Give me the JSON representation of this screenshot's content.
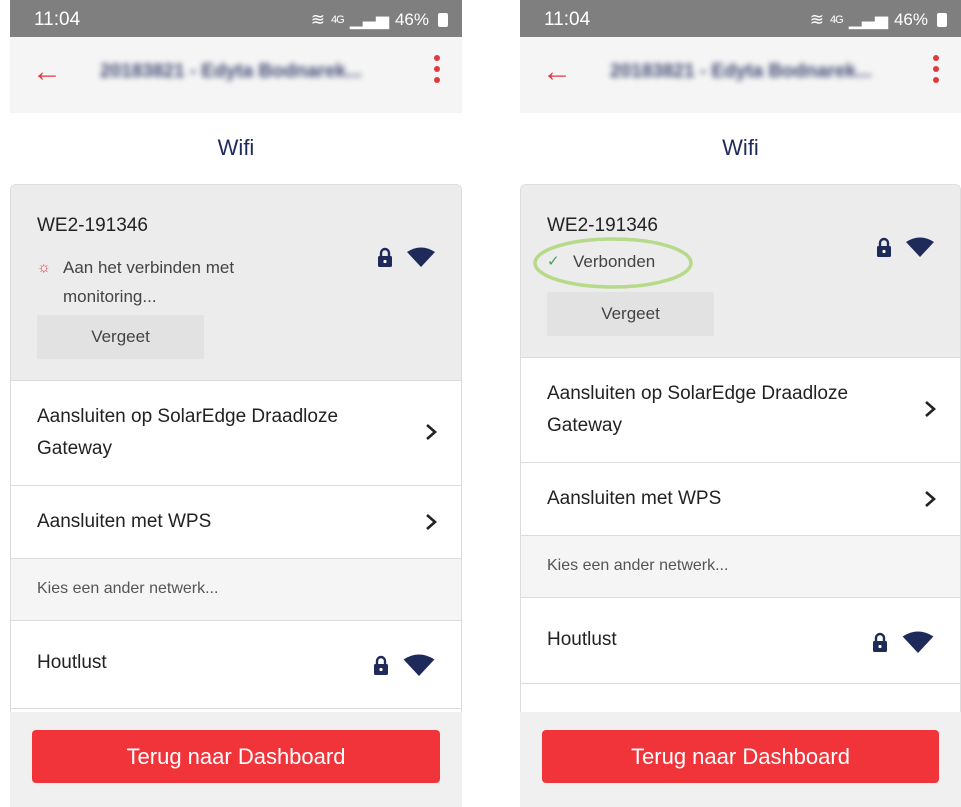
{
  "colors": {
    "accent": "#e0393e",
    "navy": "#1e2a5a",
    "cta": "#f1343a",
    "status_bar": "#7f7f7f",
    "highlight": "#b6d98a"
  },
  "screens": [
    {
      "status": {
        "time": "11:04",
        "signal": "4G",
        "battery": "46%"
      },
      "appbar": {
        "title": "20183821 - Edyta Bodnarek..."
      },
      "title": "Wifi",
      "current": {
        "ssid": "WE2-191346",
        "status": "Aan het verbinden met monitoring...",
        "forget": "Vergeet"
      },
      "option1": "Aansluiten op SolarEdge Draadloze Gateway",
      "option2": "Aansluiten met WPS",
      "hint": "Kies een ander netwerk...",
      "network": "Houtlust",
      "cta": "Terug naar Dashboard"
    },
    {
      "status": {
        "time": "11:04",
        "signal": "4G",
        "battery": "46%"
      },
      "appbar": {
        "title": "20183821 - Edyta Bodnarek..."
      },
      "title": "Wifi",
      "current": {
        "ssid": "WE2-191346",
        "status": "Verbonden",
        "forget": "Vergeet"
      },
      "option1": "Aansluiten op SolarEdge Draadloze Gateway",
      "option2": "Aansluiten met WPS",
      "hint": "Kies een ander netwerk...",
      "network": "Houtlust",
      "cta": "Terug naar Dashboard"
    }
  ]
}
